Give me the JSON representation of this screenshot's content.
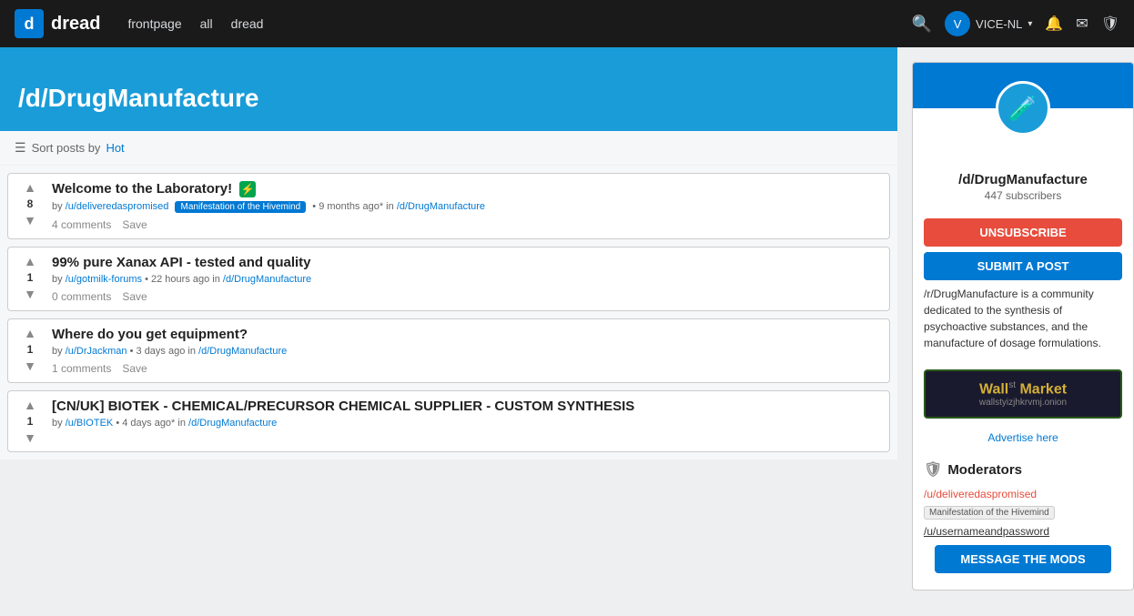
{
  "site": {
    "logo_letter": "d",
    "logo_text": "dread"
  },
  "navbar": {
    "links": [
      "frontpage",
      "all",
      "dread"
    ],
    "search_label": "search",
    "username": "VICE-NL",
    "chevron": "▾",
    "notif_icon": "🔔",
    "mail_icon": "✉",
    "shield_icon": "🛡"
  },
  "banner": {
    "title": "/d/DrugManufacture"
  },
  "sort_bar": {
    "label": "Sort posts by",
    "active": "Hot"
  },
  "posts": [
    {
      "id": 1,
      "votes": 8,
      "title": "Welcome to the Laboratory!",
      "has_badge": true,
      "badge_symbol": "⚡",
      "author": "/u/deliveredaspromised",
      "flair": "Manifestation of the Hivemind",
      "time": "9 months ago*",
      "subreddit": "/d/DrugManufacture",
      "comments": "4 comments",
      "save": "Save"
    },
    {
      "id": 2,
      "votes": 1,
      "title": "99% pure Xanax API - tested and quality",
      "has_badge": false,
      "author": "/u/gotmilk-forums",
      "flair": "",
      "time": "22 hours ago",
      "subreddit": "/d/DrugManufacture",
      "comments": "0 comments",
      "save": "Save"
    },
    {
      "id": 3,
      "votes": 1,
      "title": "Where do you get equipment?",
      "has_badge": false,
      "author": "/u/DrJackman",
      "flair": "",
      "time": "3 days ago",
      "subreddit": "/d/DrugManufacture",
      "comments": "1 comments",
      "save": "Save"
    },
    {
      "id": 4,
      "votes": 1,
      "title": "[CN/UK] BIOTEK - CHEMICAL/PRECURSOR CHEMICAL SUPPLIER - CUSTOM SYNTHESIS",
      "has_badge": false,
      "author": "/u/BIOTEK",
      "flair": "",
      "time": "4 days ago*",
      "subreddit": "/d/DrugManufacture",
      "comments": "",
      "save": ""
    }
  ],
  "sidebar": {
    "community_name": "/d/DrugManufacture",
    "subscribers": "447 subscribers",
    "unsubscribe_label": "UNSUBSCRIBE",
    "submit_label": "SUBMIT A POST",
    "description": "/r/DrugManufacture is a community dedicated to the synthesis of psychoactive substances, and the manufacture of dosage formulations.",
    "ad": {
      "title_wall": "Wall",
      "title_st": "st",
      "title_market": "Market",
      "url": "wallstyizjhkrvmj.onion"
    },
    "ad_here": "Advertise here",
    "moderators_title": "Moderators",
    "mods": [
      {
        "name": "/u/deliveredaspromised",
        "flair": "Manifestation of the Hivemind",
        "is_red": true
      },
      {
        "name": "/u/usernameandpassword",
        "flair": "",
        "is_red": false
      }
    ],
    "message_mods_label": "MESSAGE THE MODS"
  }
}
